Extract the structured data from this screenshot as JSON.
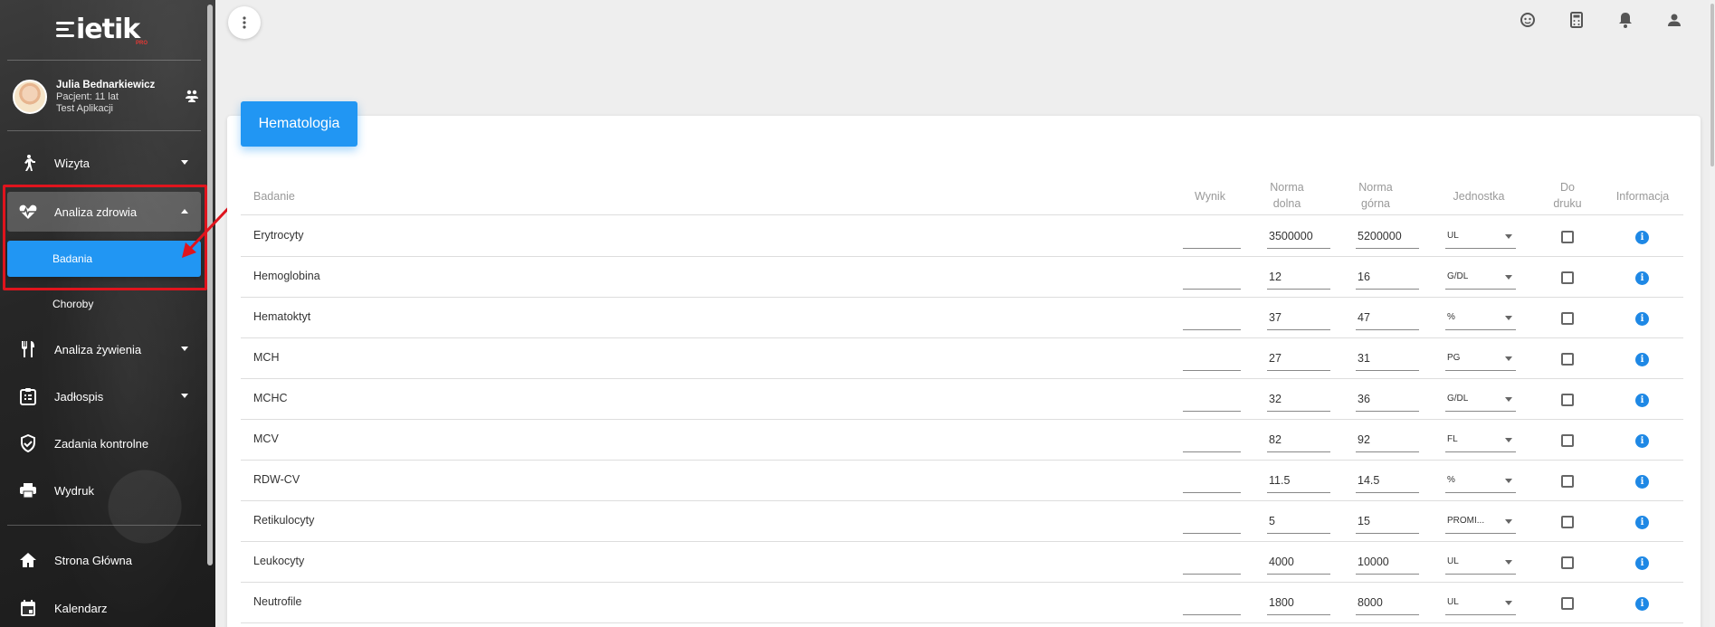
{
  "app": {
    "logo_text": "ietik",
    "logo_badge": "PRO"
  },
  "user": {
    "name": "Julia Bednarkiewicz",
    "line2": "Pacjent: 11 lat",
    "line3": "Test Aplikacji"
  },
  "sidebar": {
    "items": [
      {
        "label": "Wizyta",
        "icon": "walking-icon"
      },
      {
        "label": "Analiza zdrowia",
        "icon": "heartbeat-icon"
      },
      {
        "label": "Badania"
      },
      {
        "label": "Choroby"
      },
      {
        "label": "Analiza żywienia",
        "icon": "cutlery-icon"
      },
      {
        "label": "Jadłospis",
        "icon": "clipboard-icon"
      },
      {
        "label": "Zadania kontrolne",
        "icon": "shield-check-icon"
      },
      {
        "label": "Wydruk",
        "icon": "printer-icon"
      },
      {
        "label": "Strona Główna",
        "icon": "home-icon"
      },
      {
        "label": "Kalendarz",
        "icon": "calendar-icon"
      }
    ]
  },
  "topbar": {
    "icons": [
      "baby-face-icon",
      "calculator-icon",
      "bell-icon",
      "person-icon"
    ]
  },
  "card": {
    "title": "Hematologia"
  },
  "table": {
    "headers": {
      "badanie": "Badanie",
      "wynik": "Wynik",
      "norma_dolna_1": "Norma",
      "norma_dolna_2": "dolna",
      "norma_gorna_1": "Norma",
      "norma_gorna_2": "górna",
      "jednostka": "Jednostka",
      "do_druku_1": "Do",
      "do_druku_2": "druku",
      "informacja": "Informacja"
    },
    "rows": [
      {
        "name": "Erytrocyty",
        "wynik": "",
        "dolna": "3500000",
        "gorna": "5200000",
        "unit": "UL"
      },
      {
        "name": "Hemoglobina",
        "wynik": "",
        "dolna": "12",
        "gorna": "16",
        "unit": "G/DL"
      },
      {
        "name": "Hematoktyt",
        "wynik": "",
        "dolna": "37",
        "gorna": "47",
        "unit": "%"
      },
      {
        "name": "MCH",
        "wynik": "",
        "dolna": "27",
        "gorna": "31",
        "unit": "PG"
      },
      {
        "name": "MCHC",
        "wynik": "",
        "dolna": "32",
        "gorna": "36",
        "unit": "G/DL"
      },
      {
        "name": "MCV",
        "wynik": "",
        "dolna": "82",
        "gorna": "92",
        "unit": "FL"
      },
      {
        "name": "RDW-CV",
        "wynik": "",
        "dolna": "11.5",
        "gorna": "14.5",
        "unit": "%"
      },
      {
        "name": "Retikulocyty",
        "wynik": "",
        "dolna": "5",
        "gorna": "15",
        "unit": "PROMI..."
      },
      {
        "name": "Leukocyty",
        "wynik": "",
        "dolna": "4000",
        "gorna": "10000",
        "unit": "UL"
      },
      {
        "name": "Neutrofile",
        "wynik": "",
        "dolna": "1800",
        "gorna": "8000",
        "unit": "UL"
      }
    ]
  },
  "colors": {
    "accent": "#2196f3",
    "annotation": "#e0141d",
    "info": "#1e88e5"
  }
}
